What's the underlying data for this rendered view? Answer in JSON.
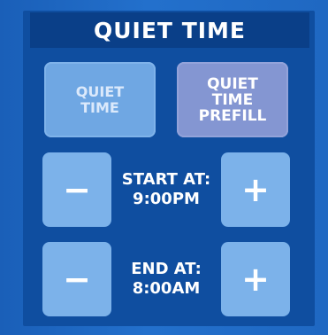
{
  "header": {
    "title": "QUIET TIME"
  },
  "mode_buttons": {
    "quiet_time": [
      "QUIET",
      "TIME"
    ],
    "quiet_time_prefill": [
      "QUIET",
      "TIME",
      "PREFILL"
    ]
  },
  "start": {
    "label": "START AT:",
    "value": "9:00PM",
    "minus": "−",
    "plus": "+"
  },
  "end": {
    "label": "END AT:",
    "value": "8:00AM",
    "minus": "−",
    "plus": "+"
  },
  "colors": {
    "background": "#1e68c4",
    "panel": "#0f4ea0",
    "title_bar": "#0a3f88",
    "button_light": "#7cb2ea",
    "button_prefill": "#8496d2",
    "text": "#ffffff"
  }
}
